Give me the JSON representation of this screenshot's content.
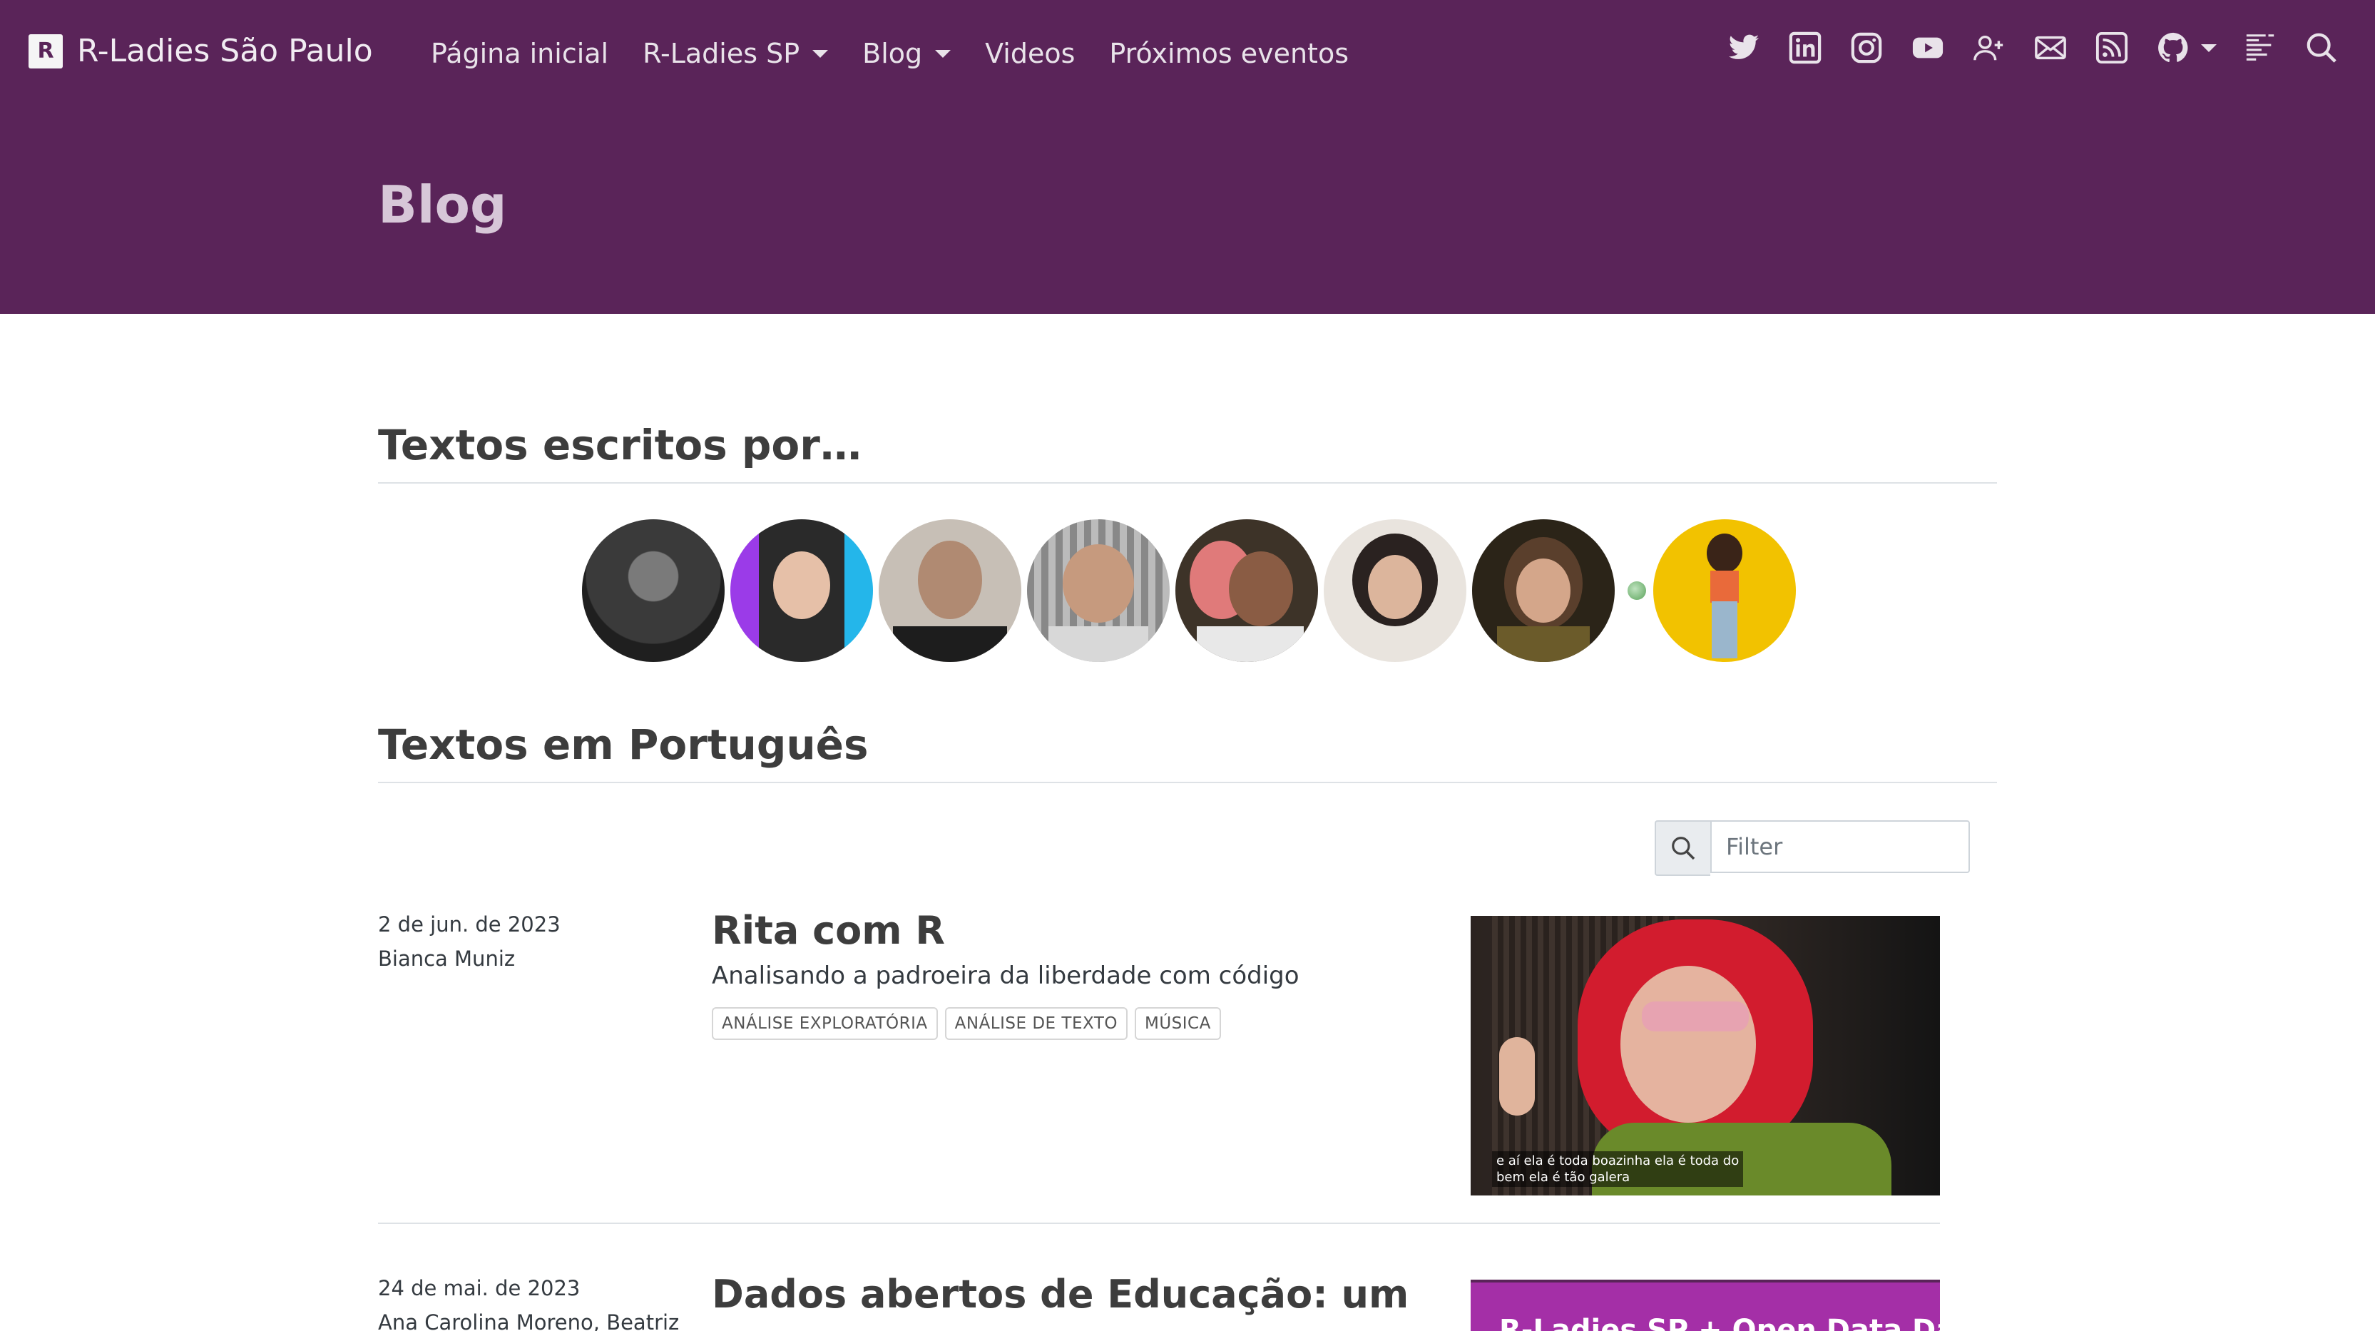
{
  "nav": {
    "brand": "R-Ladies São Paulo",
    "brand_logo": "R",
    "items": [
      {
        "label": "Página inicial",
        "dropdown": false
      },
      {
        "label": "R-Ladies SP",
        "dropdown": true
      },
      {
        "label": "Blog",
        "dropdown": true
      },
      {
        "label": "Videos",
        "dropdown": false
      },
      {
        "label": "Próximos eventos",
        "dropdown": false
      }
    ],
    "icons": [
      "twitter-icon",
      "linkedin-icon",
      "instagram-icon",
      "youtube-icon",
      "add-user-icon",
      "mail-icon",
      "rss-icon",
      "github-icon",
      "list-icon",
      "search-icon"
    ]
  },
  "header": {
    "title": "Blog"
  },
  "authors_section": {
    "title": "Textos escritos por…"
  },
  "portuguese_section": {
    "title": "Textos em Português"
  },
  "filter": {
    "placeholder": "Filter"
  },
  "posts": [
    {
      "date": "2 de jun. de 2023",
      "author": "Bianca Muniz",
      "title": "Rita com R",
      "subtitle": "Analisando a padroeira da liberdade com código",
      "tags": [
        "ANÁLISE EXPLORATÓRIA",
        "ANÁLISE DE TEXTO",
        "MÚSICA"
      ],
      "thumb_caption_1": "e aí ela é toda boazinha ela é toda do",
      "thumb_caption_2": "bem ela é tão galera"
    },
    {
      "date": "24 de mai. de 2023",
      "author": "Ana Carolina Moreno, Beatriz",
      "title": "Dados abertos de Educação: um",
      "thumb_text": "R-Ladies SP + Open Data Day"
    }
  ],
  "colors": {
    "navbar": "#5a2459",
    "title_text": "#d7c7d8",
    "accent_purple": "#a42fa7"
  }
}
